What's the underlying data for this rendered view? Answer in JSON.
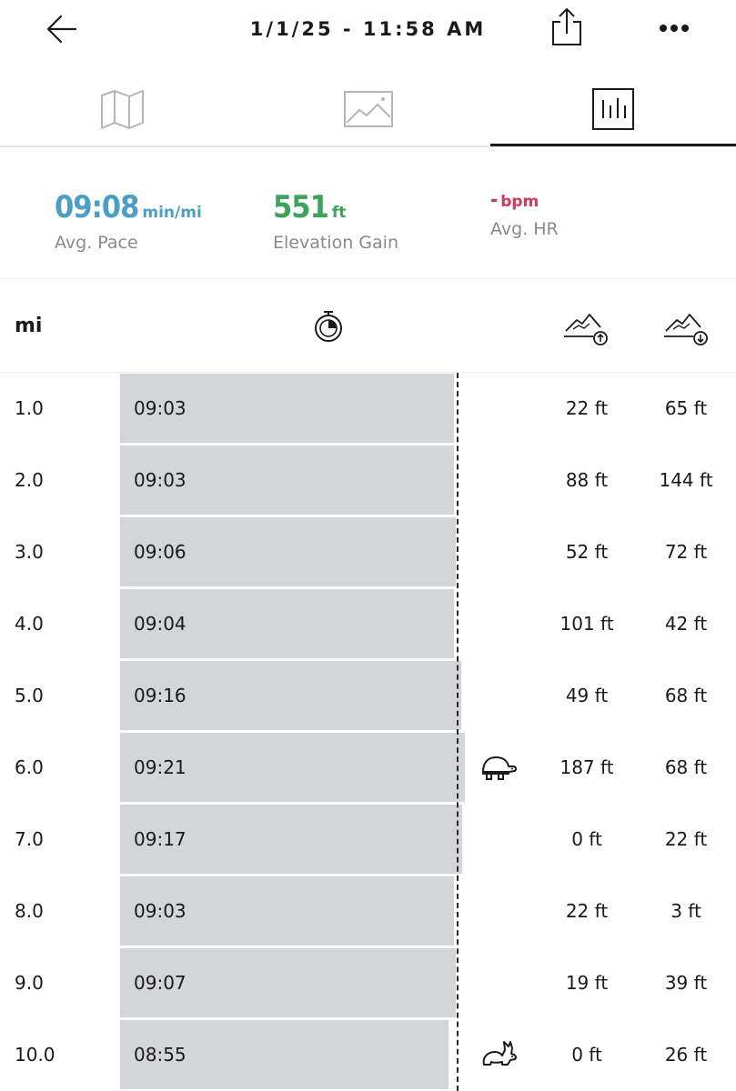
{
  "header": {
    "title": "1/1/25 - 11:58 AM"
  },
  "summary": {
    "pace": {
      "value": "09:08",
      "unit": "min/mi",
      "label": "Avg. Pace",
      "color": "#4b9fc4"
    },
    "elevation": {
      "value": "551",
      "unit": "ft",
      "label": "Elevation Gain",
      "color": "#3ea35a"
    },
    "hr": {
      "value": "-",
      "unit": "bpm",
      "label": "Avg. HR",
      "color": "#d1385a"
    }
  },
  "table": {
    "unit_header": "mi",
    "rows": [
      {
        "mi": "1.0",
        "pace": "09:03",
        "up": "22 ft",
        "down": "65 ft",
        "bar_fraction": 0.9,
        "badge": ""
      },
      {
        "mi": "2.0",
        "pace": "09:03",
        "up": "88 ft",
        "down": "144 ft",
        "bar_fraction": 0.9,
        "badge": ""
      },
      {
        "mi": "3.0",
        "pace": "09:06",
        "up": "52 ft",
        "down": "72 ft",
        "bar_fraction": 0.905,
        "badge": ""
      },
      {
        "mi": "4.0",
        "pace": "09:04",
        "up": "101 ft",
        "down": "42 ft",
        "bar_fraction": 0.9,
        "badge": ""
      },
      {
        "mi": "5.0",
        "pace": "09:16",
        "up": "49 ft",
        "down": "68 ft",
        "bar_fraction": 0.92,
        "badge": ""
      },
      {
        "mi": "6.0",
        "pace": "09:21",
        "up": "187 ft",
        "down": "68 ft",
        "bar_fraction": 0.93,
        "badge": "turtle-icon"
      },
      {
        "mi": "7.0",
        "pace": "09:17",
        "up": "0 ft",
        "down": "22 ft",
        "bar_fraction": 0.922,
        "badge": ""
      },
      {
        "mi": "8.0",
        "pace": "09:03",
        "up": "22 ft",
        "down": "3 ft",
        "bar_fraction": 0.9,
        "badge": ""
      },
      {
        "mi": "9.0",
        "pace": "09:07",
        "up": "19 ft",
        "down": "39 ft",
        "bar_fraction": 0.905,
        "badge": ""
      },
      {
        "mi": "10.0",
        "pace": "08:55",
        "up": "0 ft",
        "down": "26 ft",
        "bar_fraction": 0.885,
        "badge": "rabbit-icon"
      }
    ]
  },
  "icons": {
    "back": "back-arrow-icon",
    "share": "share-icon",
    "more": "more-icon",
    "tab_map": "map-icon",
    "tab_photos": "image-icon",
    "tab_stats": "bar-chart-icon",
    "timer": "stopwatch-icon",
    "elev_up": "elevation-gain-icon",
    "elev_down": "elevation-loss-icon"
  }
}
